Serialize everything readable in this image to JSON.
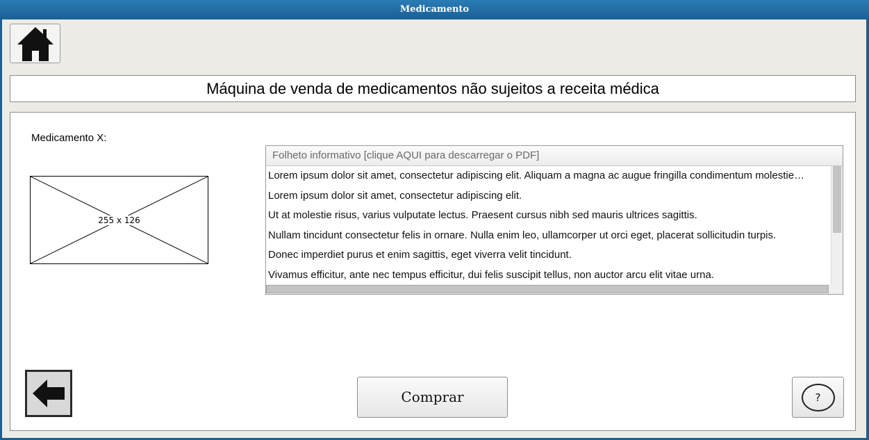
{
  "window": {
    "title": "Medicamento"
  },
  "toolbar": {
    "home_icon": "home-icon"
  },
  "banner": {
    "title": "Máquina de venda de medicamentos não sujeitos a receita médica"
  },
  "product": {
    "label": "Medicamento X:",
    "image_placeholder": "255 x 126"
  },
  "leaflet": {
    "header": "Folheto informativo [clique AQUI para descarregar o PDF]",
    "lines": [
      "Lorem ipsum dolor sit amet, consectetur adipiscing elit. Aliquam a magna ac augue fringilla condimentum molestie…",
      "Lorem ipsum dolor sit amet, consectetur adipiscing elit.",
      "Ut at molestie risus, varius vulputate lectus. Praesent cursus nibh sed mauris ultrices sagittis.",
      "Nullam tincidunt consectetur felis in ornare. Nulla enim leo, ullamcorper ut orci eget, placerat sollicitudin turpis.",
      "Donec imperdiet purus et enim sagittis, eget viverra velit tincidunt.",
      "Vivamus efficitur, ante nec tempus efficitur, dui felis suscipit tellus, non auctor arcu elit vitae urna."
    ]
  },
  "actions": {
    "back_icon": "arrow-left-icon",
    "buy_label": "Comprar",
    "help_label": "?"
  }
}
